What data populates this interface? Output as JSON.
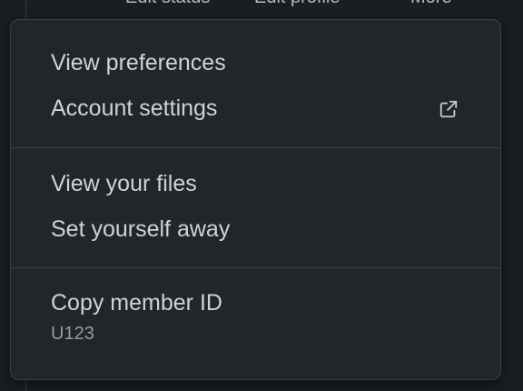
{
  "background_peek": {
    "items": [
      "Edit status",
      "Edit profile",
      "More"
    ]
  },
  "menu": {
    "sections": [
      {
        "items": [
          {
            "label": "View preferences"
          },
          {
            "label": "Account settings",
            "icon": "external-link-icon"
          }
        ]
      },
      {
        "items": [
          {
            "label": "View your files"
          },
          {
            "label": "Set yourself away"
          }
        ]
      },
      {
        "items": [
          {
            "label": "Copy member ID",
            "sublabel": "U123"
          }
        ]
      }
    ]
  },
  "colors": {
    "menu_bg": "#222529",
    "page_bg": "#1a1d21",
    "text": "#d1d2d3",
    "muted": "#9a9b9d",
    "divider": "#3c3f44"
  }
}
